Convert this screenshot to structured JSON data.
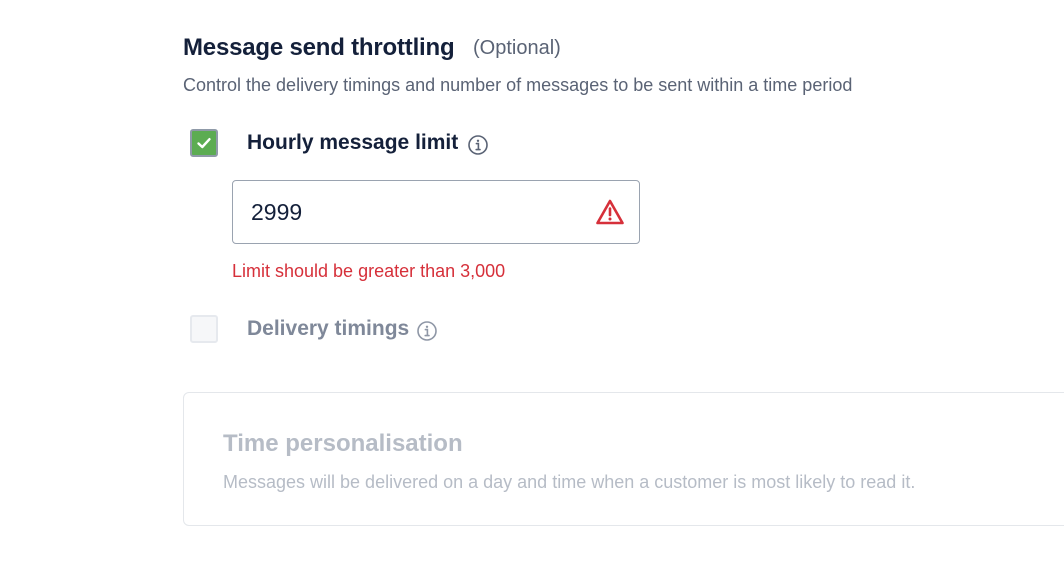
{
  "section": {
    "title": "Message send throttling",
    "optional_tag": "(Optional)",
    "description": "Control the delivery timings and number of messages to be sent within a time period"
  },
  "hourly_limit": {
    "label": "Hourly message limit",
    "checked": true,
    "info_icon": "info-circle-icon",
    "input_value": "2999",
    "error_icon": "warning-triangle-icon",
    "error_message": "Limit should be greater than 3,000"
  },
  "delivery_timings": {
    "label": "Delivery timings",
    "checked": false,
    "disabled": true,
    "info_icon": "info-circle-icon"
  },
  "time_personalisation": {
    "title": "Time personalisation",
    "description": "Messages will be delivered on a day and time when a customer is most likely to read it."
  },
  "colors": {
    "check_green": "#5cac52",
    "error_red": "#d6303a",
    "heading": "#14203a",
    "muted": "#5a6375",
    "disabled_text": "#b6bcc6"
  }
}
